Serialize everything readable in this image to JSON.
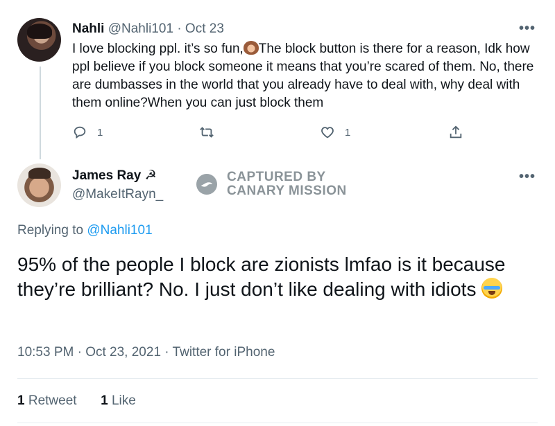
{
  "parent_tweet": {
    "display_name": "Nahli",
    "handle": "@Nahli101",
    "separator": "·",
    "date": "Oct 23",
    "text_part1": "I love blocking ppl. it’s so fun,",
    "text_part2": "The block button is there for a reason, Idk how ppl believe if you block someone it means that you’re scared of them. No, there are dumbasses in the world that you already have to deal with, why deal with them online?When you can just block them",
    "reply_count": "1",
    "like_count": "1"
  },
  "main_tweet": {
    "display_name": "James Ray ☭",
    "handle": "@MakeItRayn_",
    "replying_prefix": "Replying to",
    "replying_handle": "@Nahli101",
    "text": "95% of the people I block are zionists lmfao is it because they’re brilliant? No. I just don’t like dealing with idiots",
    "timestamp": "10:53 PM · Oct 23, 2021 · Twitter for iPhone",
    "retweet_count": "1",
    "retweet_label": "Retweet",
    "like_count": "1",
    "like_label": "Like"
  },
  "watermark": {
    "line1": "CAPTURED BY",
    "line2": "CANARY MISSION"
  },
  "icons": [
    "reply-icon",
    "retweet-icon",
    "like-icon",
    "share-icon",
    "more-icon",
    "see-no-evil-monkey-emoji",
    "crying-face-emoji",
    "canary-mission-logo"
  ],
  "colors": {
    "link": "#1d9bf0",
    "secondary_text": "#536471",
    "primary_text": "#0f1419"
  }
}
